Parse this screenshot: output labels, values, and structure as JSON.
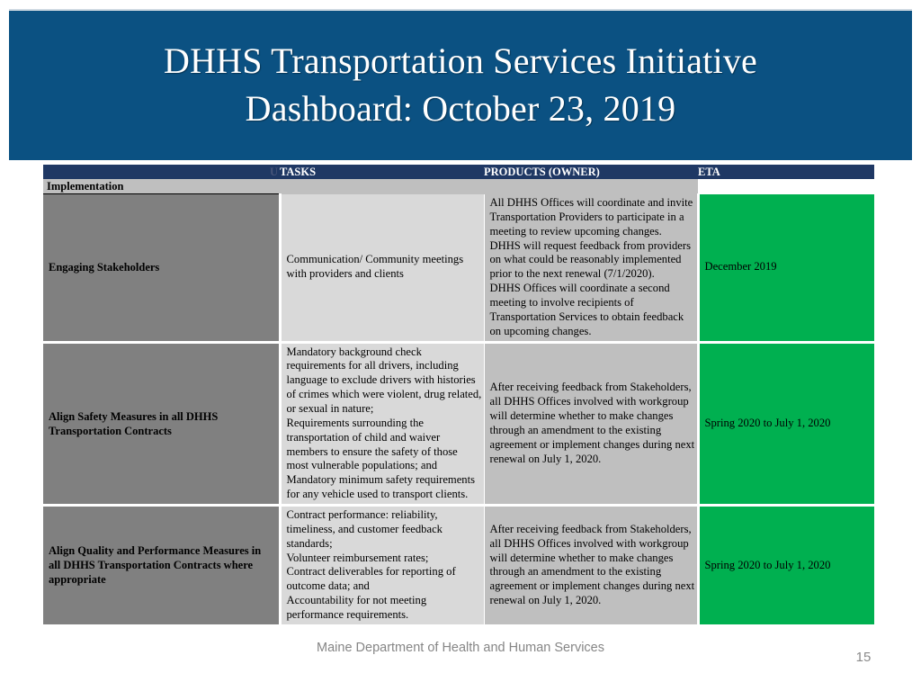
{
  "slide": {
    "title": "DHHS Transportation Services Initiative\nDashboard: October 23, 2019",
    "banner_color": "#0b5182",
    "footer": "Maine Department of Health and Human Services",
    "page_number": "15"
  },
  "table": {
    "header_color": "#1f3864",
    "columns": [
      {
        "label": "",
        "ghost": "U"
      },
      {
        "label": "TASKS"
      },
      {
        "label": "PRODUCTS (OWNER)"
      },
      {
        "label": "ETA"
      }
    ],
    "section": {
      "label": "Implementation"
    },
    "rows": [
      {
        "category": "Engaging Stakeholders",
        "tasks": "Communication/ Community meetings with providers and clients",
        "products": "All DHHS Offices will coordinate and invite Transportation Providers to participate in a meeting to review upcoming changes. DHHS will request feedback from providers on what could be reasonably implemented prior to the next renewal (7/1/2020).\nDHHS Offices will coordinate a second meeting to involve recipients of Transportation Services to obtain feedback on upcoming changes.",
        "eta": "December 2019",
        "eta_color": "#00b050"
      },
      {
        "category": "Align Safety Measures in all DHHS Transportation Contracts",
        "tasks": "Mandatory background check requirements for all drivers, including language to exclude drivers with histories of crimes which were violent, drug related, or sexual in nature;\nRequirements surrounding the transportation of child and waiver members to ensure the safety of those most vulnerable populations; and\nMandatory minimum safety requirements for any vehicle used to transport clients.",
        "products": "After receiving feedback from Stakeholders, all DHHS Offices involved with workgroup will determine whether to make changes through an amendment to the existing agreement or implement changes during next renewal on July 1, 2020.",
        "eta": "Spring 2020 to July 1, 2020",
        "eta_color": "#00b050"
      },
      {
        "category": "Align Quality and Performance Measures in all DHHS Transportation Contracts where appropriate",
        "tasks": "Contract performance: reliability, timeliness, and customer feedback standards;\nVolunteer reimbursement rates;\nContract deliverables for reporting of outcome data; and\nAccountability for not meeting performance requirements.",
        "products": "After receiving feedback from Stakeholders, all DHHS Offices involved with workgroup will determine whether to make changes through an amendment to the existing agreement or implement changes during next renewal on July 1, 2020.",
        "eta": "Spring 2020 to July 1, 2020",
        "eta_color": "#00b050"
      }
    ]
  }
}
